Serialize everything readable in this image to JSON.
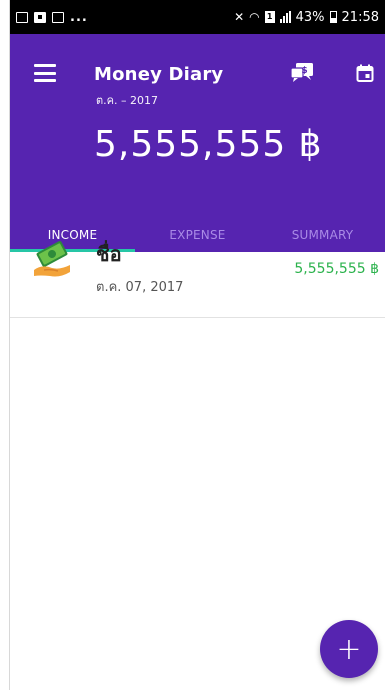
{
  "status_bar": {
    "left_overflow": "...",
    "battery_text": "43%",
    "time": "21:58",
    "sim_label": "1"
  },
  "header": {
    "title": "Money Diary",
    "subtitle": "ต.ค. – 2017",
    "total": "5,555,555 ฿",
    "colors": {
      "primary": "#5624b0",
      "accent": "#26c6a6"
    },
    "icons": [
      "menu-icon",
      "chat-money-icon",
      "calendar-icon"
    ]
  },
  "tabs": [
    {
      "label": "INCOME",
      "active": true
    },
    {
      "label": "EXPENSE",
      "active": false
    },
    {
      "label": "SUMMARY",
      "active": false
    }
  ],
  "entries": [
    {
      "name": "ชื่อ",
      "date": "ต.ค. 07, 2017",
      "amount": "5,555,555 ฿",
      "amount_color": "#2bb24c",
      "icon": "money-hand-icon"
    }
  ],
  "fab": {
    "label": "+"
  }
}
